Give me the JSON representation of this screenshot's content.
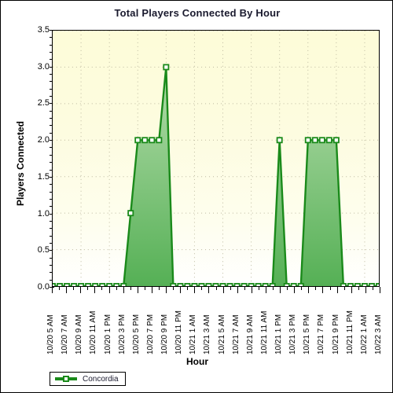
{
  "chart_data": {
    "type": "area",
    "title": "Total Players Connected By Hour",
    "xlabel": "Hour",
    "ylabel": "Players Connected",
    "ylim": [
      0,
      3.5
    ],
    "ytick_labels": [
      "0.0",
      "0.5",
      "1.0",
      "1.5",
      "2.0",
      "2.5",
      "3.0",
      "3.5"
    ],
    "ytick_values": [
      0,
      0.5,
      1,
      1.5,
      2,
      2.5,
      3,
      3.5
    ],
    "grid": true,
    "legend_position": "bottom-left",
    "legend": [
      "Concordia"
    ],
    "series": [
      {
        "name": "Concordia",
        "color": "#1a8a1a",
        "fill_top": "#aed9a4",
        "fill_bottom": "#5cb85c",
        "values": [
          0,
          0,
          0,
          0,
          0,
          0,
          0,
          0,
          0,
          0,
          0,
          1,
          2,
          2,
          2,
          2,
          3,
          0,
          0,
          0,
          0,
          0,
          0,
          0,
          0,
          0,
          0,
          0,
          0,
          0,
          0,
          0,
          2,
          0,
          0,
          0,
          2,
          2,
          2,
          2,
          2,
          0,
          0,
          0,
          0,
          0,
          0
        ]
      }
    ],
    "x": [
      "10/20 5 AM",
      "10/20 6 AM",
      "10/20 7 AM",
      "10/20 8 AM",
      "10/20 9 AM",
      "10/20 10 AM",
      "10/20 11 AM",
      "10/20 12 PM",
      "10/20 1 PM",
      "10/20 2 PM",
      "10/20 3 PM",
      "10/20 4 PM",
      "10/20 5 PM",
      "10/20 6 PM",
      "10/20 7 PM",
      "10/20 8 PM",
      "10/20 9 PM",
      "10/20 10 PM",
      "10/20 11 PM",
      "10/21 12 AM",
      "10/21 1 AM",
      "10/21 2 AM",
      "10/21 3 AM",
      "10/21 4 AM",
      "10/21 5 AM",
      "10/21 6 AM",
      "10/21 7 AM",
      "10/21 8 AM",
      "10/21 9 AM",
      "10/21 10 AM",
      "10/21 11 AM",
      "10/21 12 PM",
      "10/21 1 PM",
      "10/21 2 PM",
      "10/21 3 PM",
      "10/21 4 PM",
      "10/21 5 PM",
      "10/21 6 PM",
      "10/21 7 PM",
      "10/21 8 PM",
      "10/21 9 PM",
      "10/21 10 PM",
      "10/21 11 PM",
      "10/22 12 AM",
      "10/22 1 AM",
      "10/22 2 AM",
      "10/22 3 AM"
    ],
    "xtick_labels": [
      "10/20 5 AM",
      "10/20 7 AM",
      "10/20 9 AM",
      "10/20 11 AM",
      "10/20 1 PM",
      "10/20 3 PM",
      "10/20 5 PM",
      "10/20 7 PM",
      "10/20 9 PM",
      "10/20 11 PM",
      "10/21 1 AM",
      "10/21 3 AM",
      "10/21 5 AM",
      "10/21 7 AM",
      "10/21 9 AM",
      "10/21 11 AM",
      "10/21 1 PM",
      "10/21 3 PM",
      "10/21 5 PM",
      "10/21 7 PM",
      "10/21 9 PM",
      "10/21 11 PM",
      "10/22 1 AM",
      "10/22 3 AM"
    ]
  },
  "legend": {
    "series_label": "Concordia"
  }
}
